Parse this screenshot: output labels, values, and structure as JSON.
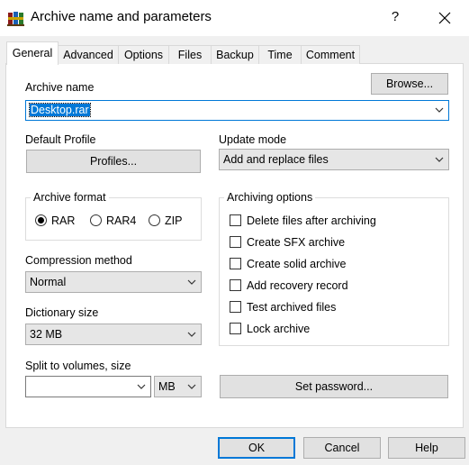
{
  "window": {
    "title": "Archive name and parameters",
    "help_label": "?",
    "app_icon": "winrar-books-icon",
    "close_icon": "close-icon"
  },
  "tabs": [
    {
      "label": "General",
      "active": true
    },
    {
      "label": "Advanced",
      "active": false
    },
    {
      "label": "Options",
      "active": false
    },
    {
      "label": "Files",
      "active": false
    },
    {
      "label": "Backup",
      "active": false
    },
    {
      "label": "Time",
      "active": false
    },
    {
      "label": "Comment",
      "active": false
    }
  ],
  "general": {
    "archive_name_label": "Archive name",
    "archive_name_value": "Desktop.rar",
    "browse_label": "Browse...",
    "default_profile_label": "Default Profile",
    "profiles_label": "Profiles...",
    "update_mode_label": "Update mode",
    "update_mode_value": "Add and replace files",
    "archive_format_label": "Archive format",
    "formats": [
      {
        "label": "RAR",
        "selected": true
      },
      {
        "label": "RAR4",
        "selected": false
      },
      {
        "label": "ZIP",
        "selected": false
      }
    ],
    "compression_method_label": "Compression method",
    "compression_method_value": "Normal",
    "dictionary_size_label": "Dictionary size",
    "dictionary_size_value": "32 MB",
    "split_label": "Split to volumes, size",
    "split_value": "",
    "split_unit": "MB",
    "archiving_options_label": "Archiving options",
    "options": [
      {
        "label": "Delete files after archiving",
        "checked": false
      },
      {
        "label": "Create SFX archive",
        "checked": false
      },
      {
        "label": "Create solid archive",
        "checked": false
      },
      {
        "label": "Add recovery record",
        "checked": false
      },
      {
        "label": "Test archived files",
        "checked": false
      },
      {
        "label": "Lock archive",
        "checked": false
      }
    ],
    "set_password_label": "Set password..."
  },
  "footer": {
    "ok_label": "OK",
    "cancel_label": "Cancel",
    "help_label": "Help"
  },
  "colors": {
    "accent": "#0078d7",
    "panel": "#ffffff",
    "dialog": "#f0f0f0"
  }
}
